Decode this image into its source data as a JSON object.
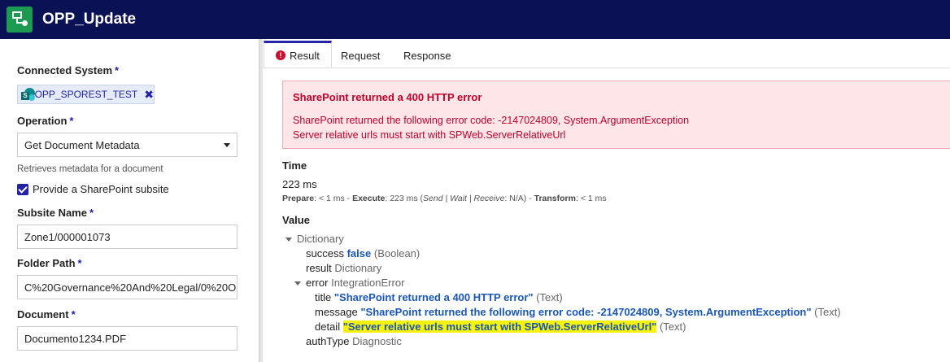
{
  "header": {
    "title": "OPP_Update"
  },
  "left": {
    "connected_system": {
      "label": "Connected System",
      "required": "*",
      "value": "OPP_SPOREST_TEST",
      "remove": "✖"
    },
    "operation": {
      "label": "Operation",
      "required": "*",
      "value": "Get Document Metadata",
      "help": "Retrieves metadata for a document"
    },
    "subsite_checkbox": {
      "label": "Provide a SharePoint subsite",
      "checked": true
    },
    "subsite_name": {
      "label": "Subsite Name",
      "required": "*",
      "value": "Zone1/000001073"
    },
    "folder_path": {
      "label": "Folder Path",
      "required": "*",
      "value": "C%20Governance%20And%20Legal/0%20O"
    },
    "document": {
      "label": "Document",
      "required": "*",
      "value": "Documento1234.PDF"
    }
  },
  "tabs": [
    {
      "label": "Result",
      "active": true,
      "icon": "alert-icon"
    },
    {
      "label": "Request",
      "active": false
    },
    {
      "label": "Response",
      "active": false
    }
  ],
  "error": {
    "title": "SharePoint returned a 400 HTTP error",
    "line1": "SharePoint returned the following error code: -2147024809, System.ArgumentException",
    "line2": "Server relative urls must start with SPWeb.ServerRelativeUrl"
  },
  "time": {
    "label": "Time",
    "value": "223 ms",
    "prepare_label": "Prepare",
    "prepare_value": ": < 1 ms - ",
    "execute_label": "Execute",
    "execute_value": ": 223 ms (",
    "breakdown": "Send | Wait | Receive",
    "breakdown_value": ": N/A) - ",
    "transform_label": "Transform",
    "transform_value": ": < 1 ms"
  },
  "value": {
    "label": "Value",
    "root": "Dictionary",
    "success_key": "success",
    "success_val": "false",
    "success_type": "(Boolean)",
    "result_key": "result",
    "result_type": "Dictionary",
    "error_key": "error",
    "error_type": "IntegrationError",
    "title_key": "title",
    "title_val": "\"SharePoint returned a 400 HTTP error\"",
    "title_type": "(Text)",
    "message_key": "message",
    "message_val": "\"SharePoint returned the following error code: -2147024809, System.ArgumentException\"",
    "message_type": "(Text)",
    "detail_key": "detail",
    "detail_val": "\"Server relative urls must start with SPWeb.ServerRelativeUrl\"",
    "detail_type": "(Text)",
    "auth_key": "authType",
    "auth_val": "Diagnostic"
  },
  "colors": {
    "header": "#0b1155",
    "accent": "#2322a8",
    "error": "#c0002a",
    "highlight": "#f6f20a"
  }
}
